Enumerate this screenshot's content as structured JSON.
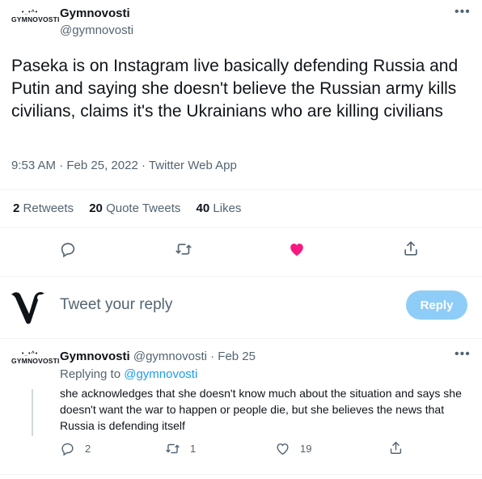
{
  "tweet": {
    "logo_text": "GYMNOVOSTI",
    "display_name": "Gymnovosti",
    "handle": "@gymnovosti",
    "text": "Paseka is on Instagram live basically defending Russia and Putin and saying she doesn't believe the Russian army kills civilians, claims it's the Ukrainians who are killing civilians",
    "time": "9:53 AM",
    "dot": "·",
    "date": "Feb 25, 2022",
    "source": "Twitter Web App",
    "stats": {
      "retweets_count": "2",
      "retweets_label": "Retweets",
      "quotes_count": "20",
      "quotes_label": "Quote Tweets",
      "likes_count": "40",
      "likes_label": "Likes"
    },
    "like_color": "#f91880"
  },
  "composer": {
    "placeholder": "Tweet your reply",
    "reply_label": "Reply"
  },
  "reply_tweet": {
    "logo_text": "GYMNOVOSTI",
    "display_name": "Gymnovosti",
    "handle": "@gymnovosti",
    "dot": "·",
    "date": "Feb 25",
    "replying_to_label": "Replying to",
    "replying_to_handle": "@gymnovosti",
    "text": "she acknowledges that she doesn't know much about the situation and says she doesn't want the war to happen or people die, but she believes the news that Russia is defending itself",
    "reply_count": "2",
    "retweet_count": "1",
    "like_count": "19"
  },
  "icons": {
    "more": "more-icon",
    "reply": "reply-icon",
    "retweet": "retweet-icon",
    "like": "heart-icon",
    "share": "share-icon"
  },
  "colors": {
    "accent": "#1d9bf0",
    "reply_button": "#8ecdf8",
    "muted_text": "#536471"
  }
}
